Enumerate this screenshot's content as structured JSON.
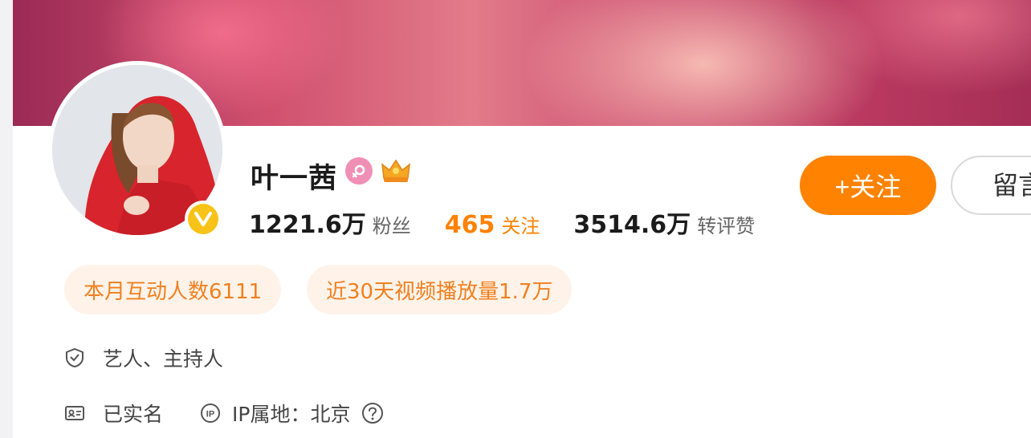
{
  "profile": {
    "name": "叶一茜",
    "stats": {
      "fans_num": "1221.6万",
      "fans_label": "粉丝",
      "follow_num": "465",
      "follow_label": "关注",
      "likes_num": "3514.6万",
      "likes_label": "转评赞"
    },
    "actions": {
      "follow_label": "+关注",
      "message_label": "留言"
    },
    "tags": {
      "interact": "本月互动人数6111",
      "video": "近30天视频播放量1.7万"
    },
    "info": {
      "occupation": "艺人、主持人",
      "verified": "已实名",
      "ip_location": "IP属地：北京"
    }
  },
  "icons": {
    "verify": "verify-v-icon",
    "gender": "female-icon",
    "crown": "crown-icon",
    "occupation": "shield-icon",
    "id": "id-card-icon",
    "ip": "ip-icon",
    "help": "question-icon"
  },
  "colors": {
    "accent": "#ff8200",
    "tag_bg": "#fff3e9",
    "verify": "#f7c318"
  }
}
